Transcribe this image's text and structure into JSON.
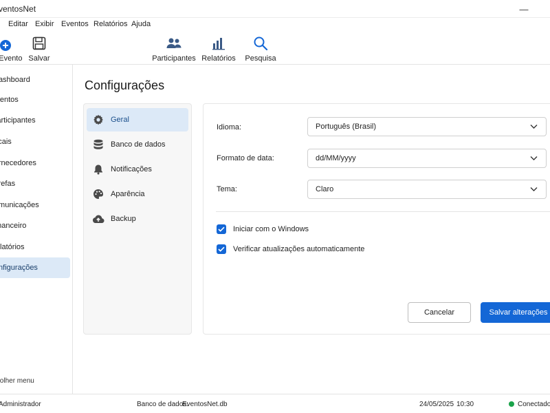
{
  "app": {
    "title": "EventosNet"
  },
  "menu": [
    "Editar",
    "Exibir",
    "Eventos",
    "Relatórios",
    "Ajuda"
  ],
  "toolbar": {
    "new_event": "Novo Evento",
    "save": "Salvar",
    "participants": "Participantes",
    "reports": "Relatórios",
    "search": "Pesquisa"
  },
  "sidebar": {
    "items": [
      {
        "label": "Dashboard"
      },
      {
        "label": "Eventos"
      },
      {
        "label": "Participantes"
      },
      {
        "label": "Locais"
      },
      {
        "label": "Fornecedores"
      },
      {
        "label": "Tarefas"
      },
      {
        "label": "Comunicações"
      },
      {
        "label": "Financeiro"
      },
      {
        "label": "Relatórios"
      },
      {
        "label": "Configurações"
      }
    ],
    "collapse_label": "Recolher menu"
  },
  "page": {
    "title": "Configurações",
    "nav": [
      {
        "label": "Geral",
        "icon": "gear-icon"
      },
      {
        "label": "Banco de dados",
        "icon": "database-icon"
      },
      {
        "label": "Notificações",
        "icon": "bell-icon"
      },
      {
        "label": "Aparência",
        "icon": "palette-icon"
      },
      {
        "label": "Backup",
        "icon": "cloud-upload-icon"
      }
    ]
  },
  "general": {
    "language_label": "Idioma:",
    "language_value": "Português (Brasil)",
    "date_format_label": "Formato de data:",
    "date_format_value": "dd/MM/yyyy",
    "theme_label": "Tema:",
    "theme_value": "Claro",
    "start_with_windows": "Iniciar com o Windows",
    "auto_update": "Verificar atualizações automaticamente",
    "cancel": "Cancelar",
    "save_changes": "Salvar alterações"
  },
  "status": {
    "user": "Administrador",
    "db_label": "Banco de dados:",
    "db_value": "EventosNet.db",
    "date": "24/05/2025",
    "time": "10:30",
    "connection": "Conectado"
  },
  "colors": {
    "accent": "#1467d6",
    "active_bg": "#dce9f7",
    "connected": "#1aa34a"
  }
}
